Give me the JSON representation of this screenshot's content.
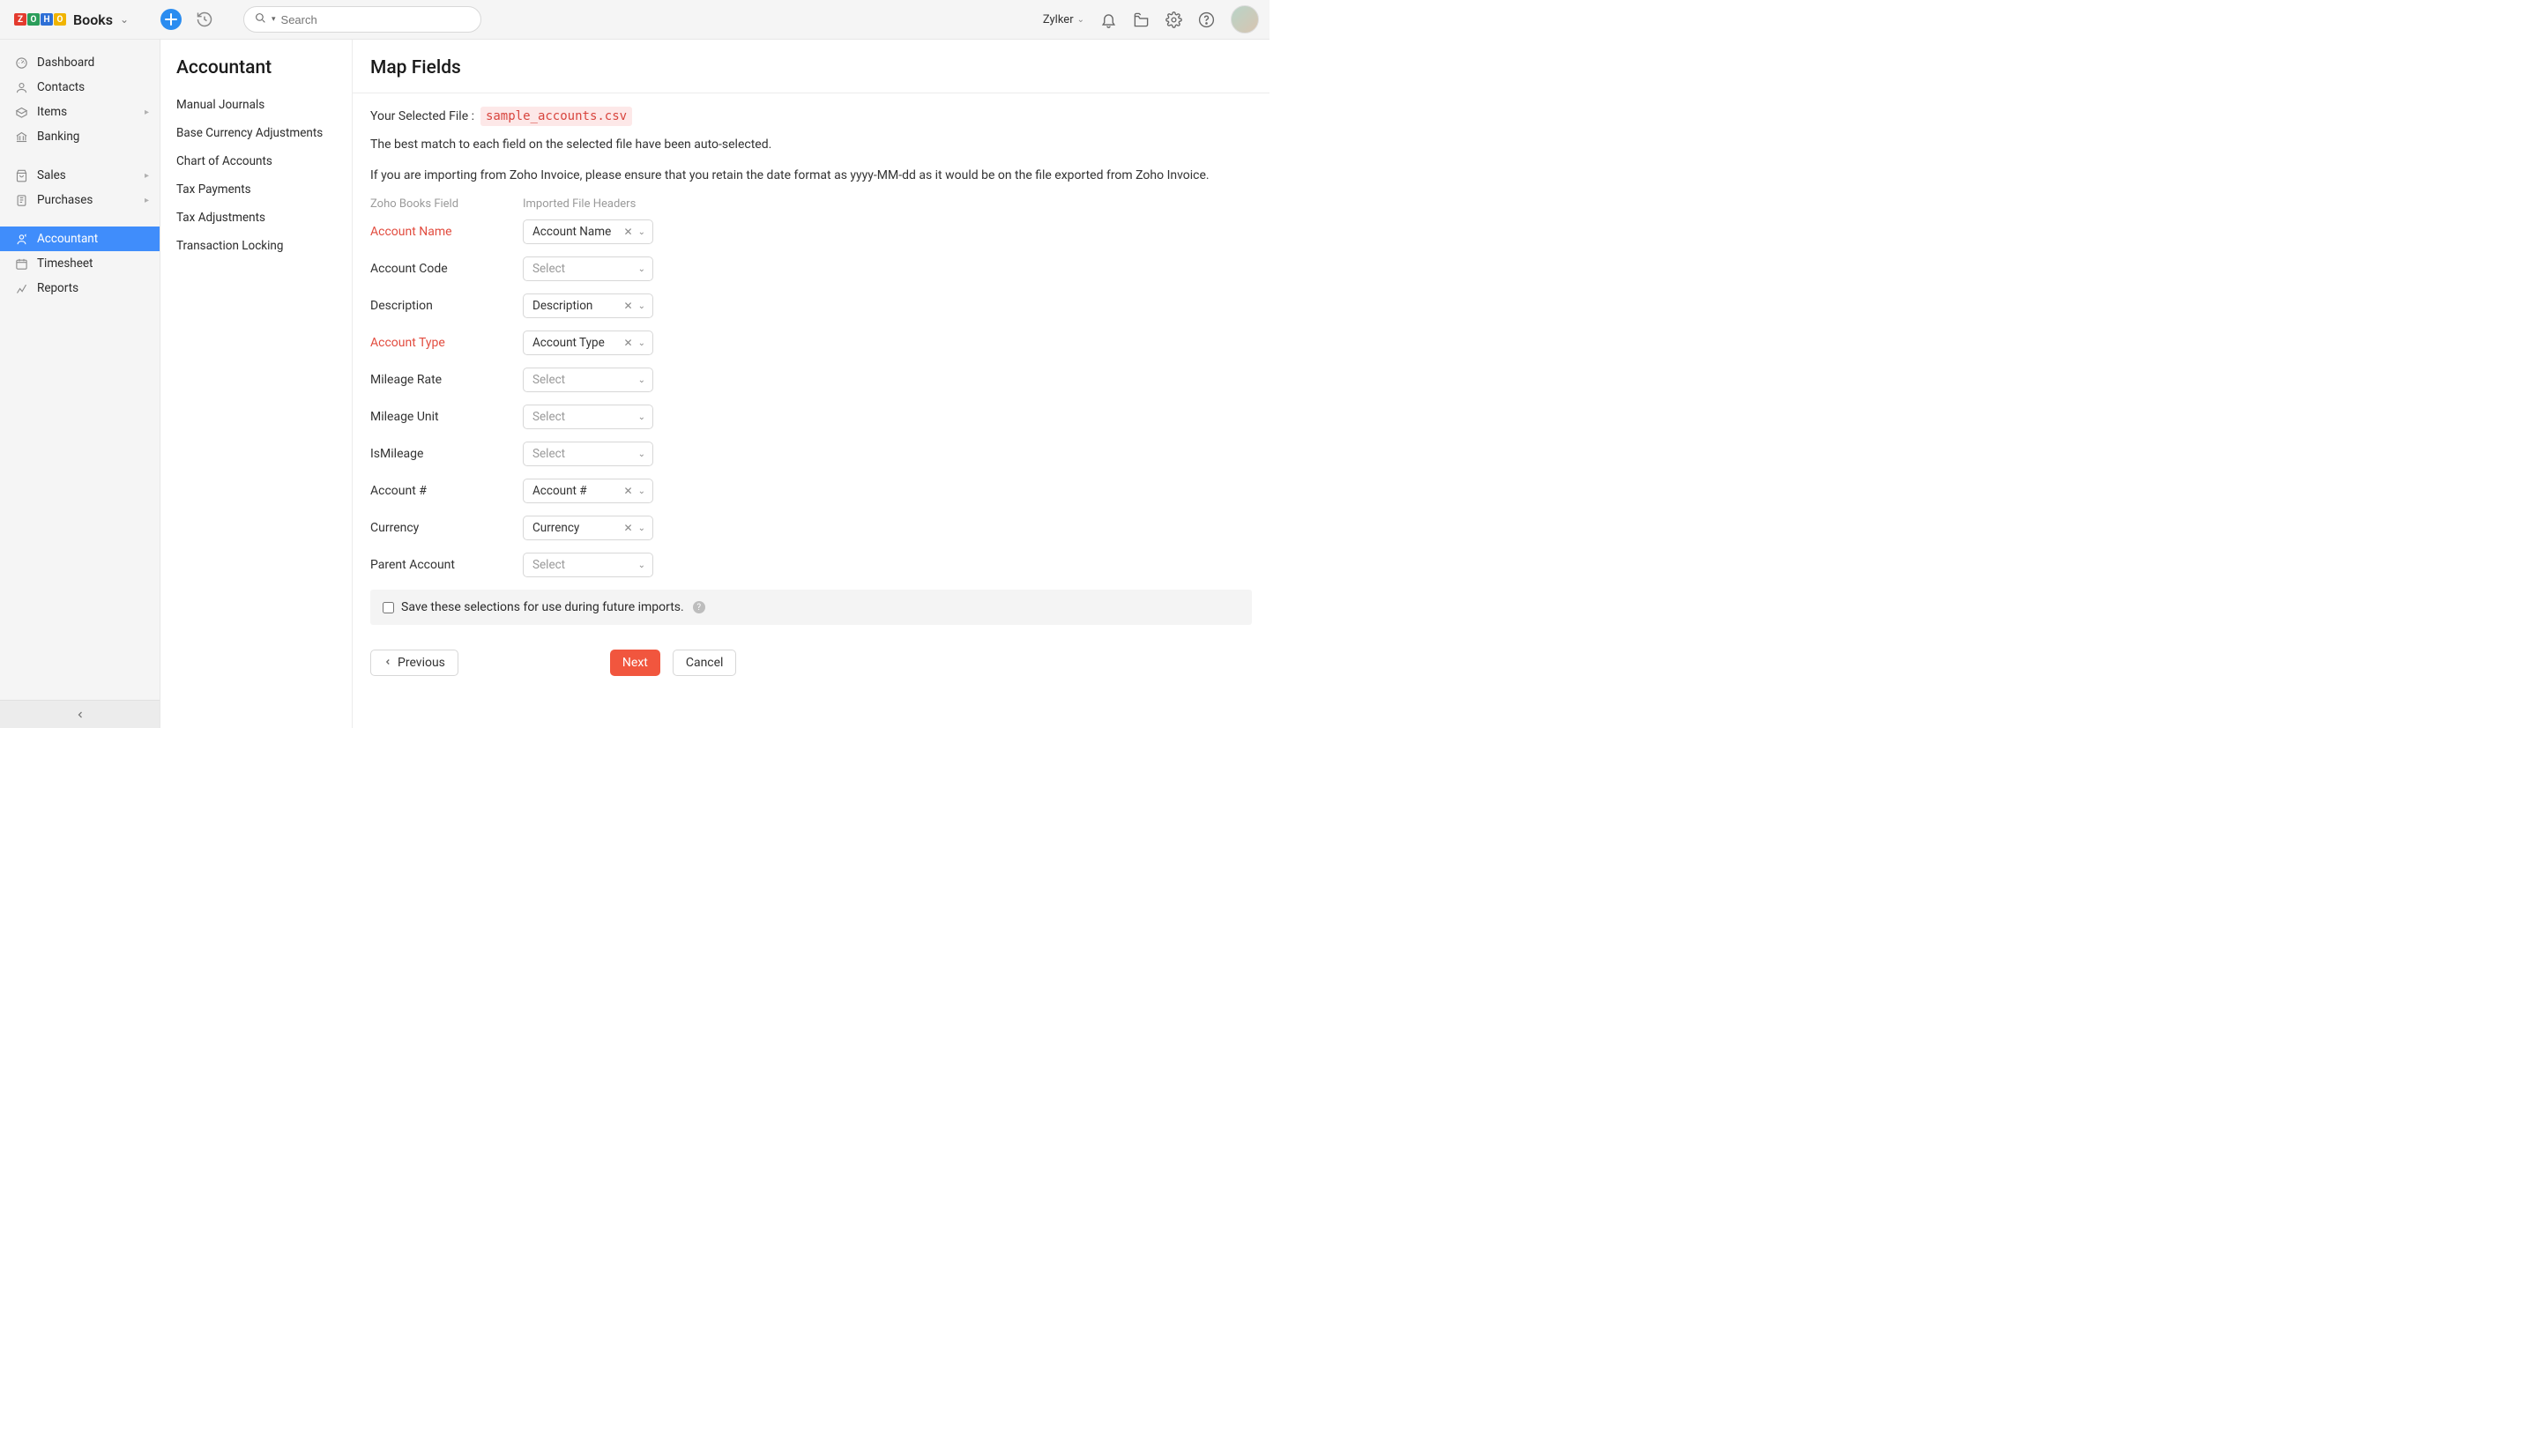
{
  "header": {
    "brand_word": "Books",
    "search_placeholder": "Search",
    "org_name": "Zylker"
  },
  "mainnav": {
    "items": [
      {
        "label": "Dashboard",
        "icon": "dashboard",
        "expandable": false
      },
      {
        "label": "Contacts",
        "icon": "contacts",
        "expandable": false
      },
      {
        "label": "Items",
        "icon": "items",
        "expandable": true
      },
      {
        "label": "Banking",
        "icon": "banking",
        "expandable": false
      },
      {
        "label": "Sales",
        "icon": "sales",
        "expandable": true
      },
      {
        "label": "Purchases",
        "icon": "purchases",
        "expandable": true
      },
      {
        "label": "Accountant",
        "icon": "accountant",
        "expandable": false,
        "active": true
      },
      {
        "label": "Timesheet",
        "icon": "timesheet",
        "expandable": false
      },
      {
        "label": "Reports",
        "icon": "reports",
        "expandable": false
      }
    ]
  },
  "subnav": {
    "title": "Accountant",
    "items": [
      "Manual Journals",
      "Base Currency Adjustments",
      "Chart of Accounts",
      "Tax Payments",
      "Tax Adjustments",
      "Transaction Locking"
    ]
  },
  "page": {
    "title": "Map Fields",
    "selected_file_label": "Your Selected File :",
    "selected_file_name": "sample_accounts.csv",
    "hint1": "The best match to each field on the selected file have been auto-selected.",
    "hint2": "If you are importing from Zoho Invoice, please ensure that you retain the date format as yyyy-MM-dd as it would be on the file exported from Zoho Invoice.",
    "col1": "Zoho Books Field",
    "col2": "Imported File Headers",
    "select_placeholder": "Select",
    "fields": [
      {
        "label": "Account Name",
        "required": true,
        "value": "Account Name"
      },
      {
        "label": "Account Code",
        "required": false,
        "value": ""
      },
      {
        "label": "Description",
        "required": false,
        "value": "Description"
      },
      {
        "label": "Account Type",
        "required": true,
        "value": "Account Type"
      },
      {
        "label": "Mileage Rate",
        "required": false,
        "value": ""
      },
      {
        "label": "Mileage Unit",
        "required": false,
        "value": ""
      },
      {
        "label": "IsMileage",
        "required": false,
        "value": ""
      },
      {
        "label": "Account #",
        "required": false,
        "value": "Account #"
      },
      {
        "label": "Currency",
        "required": false,
        "value": "Currency"
      },
      {
        "label": "Parent Account",
        "required": false,
        "value": ""
      }
    ],
    "save_selection_label": "Save these selections for use during future imports.",
    "buttons": {
      "previous": "Previous",
      "next": "Next",
      "cancel": "Cancel"
    }
  }
}
